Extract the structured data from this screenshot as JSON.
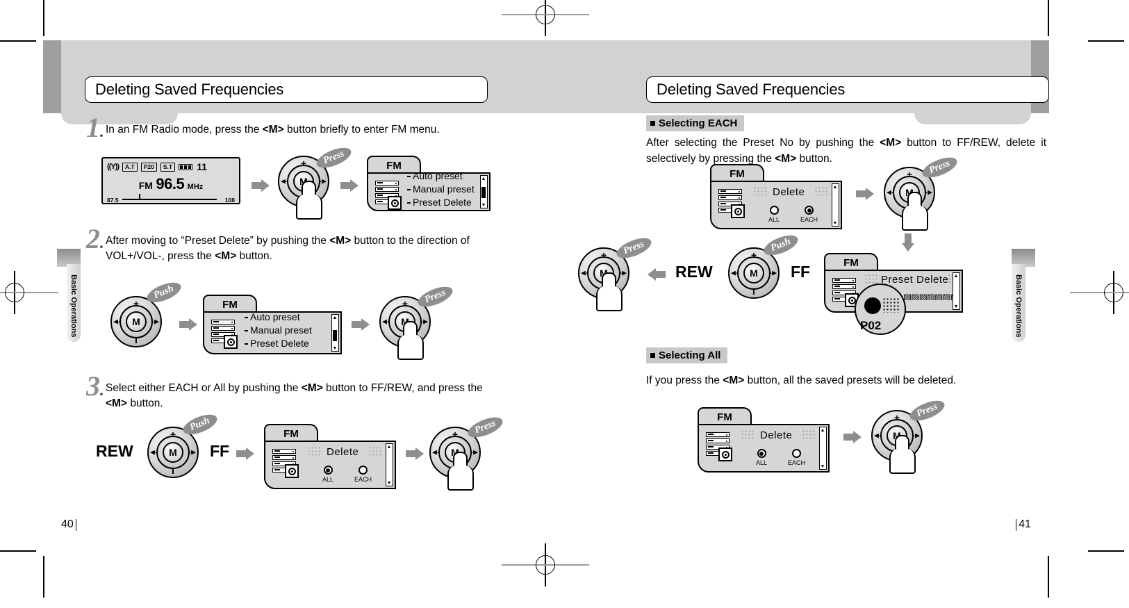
{
  "document": {
    "left_page": {
      "number": "40",
      "title": "Deleting Saved Frequencies",
      "side_tab": "Basic Operations",
      "steps": [
        {
          "num": "1",
          "text_html": "In an FM Radio mode, press the <b>&lt;M&gt;</b> button briefly to enter FM menu."
        },
        {
          "num": "2",
          "text_html": "After moving to “Preset Delete” by pushing the <b>&lt;M&gt;</b> button to the direction of VOL+/VOL-, press the <b>&lt;M&gt;</b> button."
        },
        {
          "num": "3",
          "text_html": "Select either EACH or All by pushing the <b>&lt;M&gt;</b> button to FF/REW, and press the <b>&lt;M&gt;</b> button."
        }
      ]
    },
    "right_page": {
      "number": "41",
      "title": "Deleting Saved Frequencies",
      "side_tab": "Basic Operations",
      "sections": [
        {
          "heading": "Selecting EACH",
          "body_html": "After selecting the Preset No by pushing the <b>&lt;M&gt;</b> button to FF/REW, delete it selectively by pressing the <b>&lt;M&gt;</b> button."
        },
        {
          "heading": "Selecting All",
          "body_html": "If you press the <b>&lt;M&gt;</b> button, all the saved presets will be deleted."
        }
      ]
    }
  },
  "lcd_display": {
    "antenna_icon": "antenna-icon",
    "auto_tune_label": "A.T",
    "preset_label": "P20",
    "stereo_label": "S.T",
    "battery_icon": "battery-icon",
    "battery_value": "11",
    "band": "FM",
    "frequency": "96.5",
    "unit": "MHz",
    "scale_min": "87.5",
    "scale_max": "108"
  },
  "dial": {
    "center_label": "M",
    "plus_label": "+",
    "minus_label": "I",
    "prev_icon": "rewind-icon",
    "next_icon": "fast-forward-icon"
  },
  "callouts": {
    "press": "Press",
    "push": "Push"
  },
  "direction_labels": {
    "rew": "REW",
    "ff": "FF"
  },
  "menu_screen": {
    "tab_label": "FM",
    "items": [
      "Auto  preset",
      "Manual preset",
      "Preset Delete"
    ],
    "selected_step1": "Auto  preset",
    "selected_step2": "Preset Delete"
  },
  "delete_screen": {
    "tab_label": "FM",
    "title": "Delete",
    "option_all": "ALL",
    "option_each": "EACH",
    "step3_selected": "ALL",
    "each_section_selected": "EACH",
    "all_section_selected": "ALL"
  },
  "preset_delete_screen": {
    "tab_label": "FM",
    "title": "Preset Delete",
    "preset_label": "P02"
  },
  "colors": {
    "header_band": "#d2d2d2",
    "header_band_dark": "#9e9e9e",
    "section_heading_bg": "#c8c8c8",
    "callout_bg": "#8e8e8e",
    "arrow_gray": "#8e8e8e",
    "screen_bg": "#d6d6d6",
    "lcd_bg": "#dcdcdc"
  }
}
